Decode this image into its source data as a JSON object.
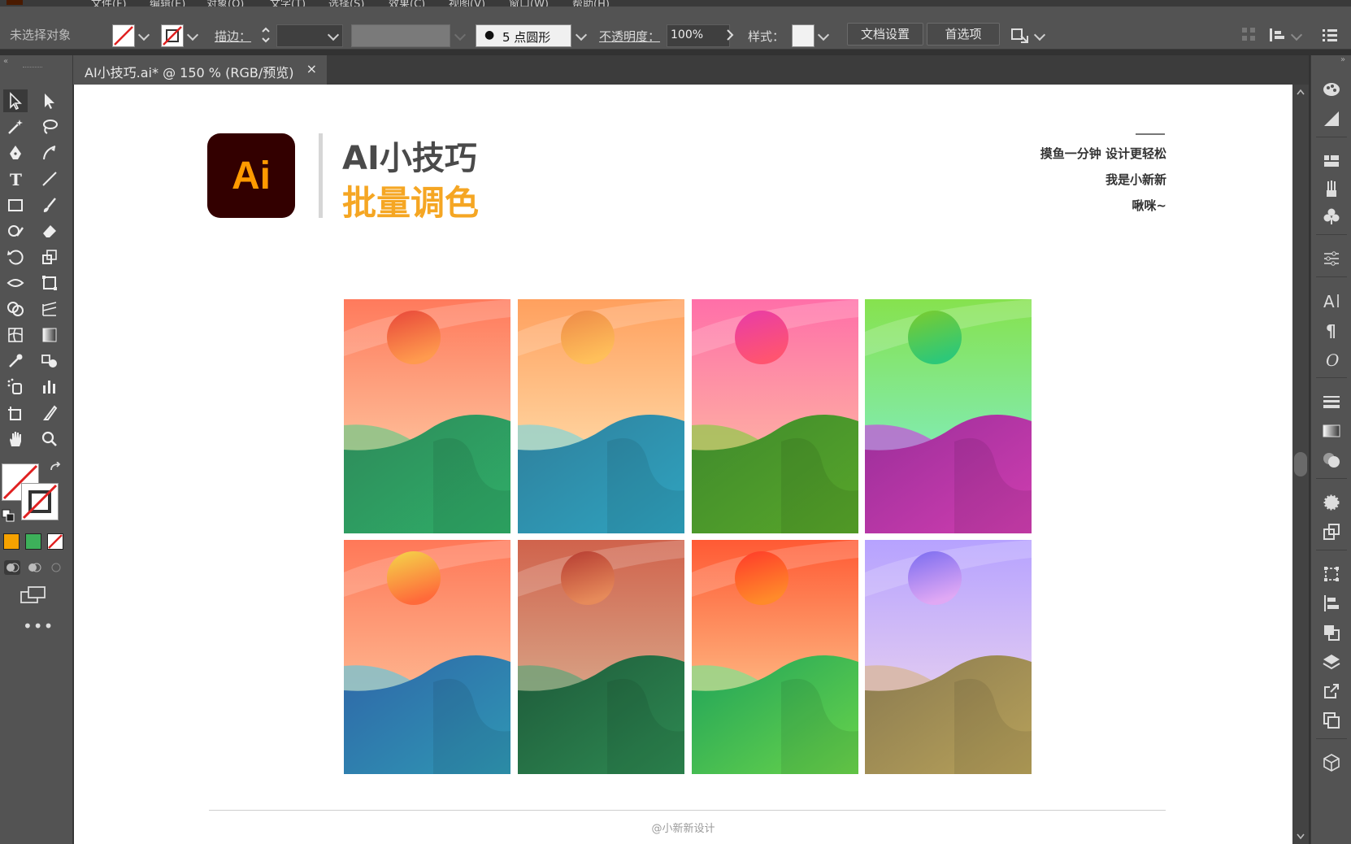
{
  "menubar": {
    "app_icon": "ai-app-icon",
    "items": [
      "文件(F)",
      "编辑(E)",
      "对象(O)",
      "文字(T)",
      "选择(S)",
      "效果(C)",
      "视图(V)",
      "窗口(W)",
      "帮助(H)"
    ]
  },
  "control_bar": {
    "selection_status": "未选择对象",
    "stroke_label": "描边：",
    "brush_label": "5 点圆形",
    "opacity_label": "不透明度：",
    "opacity_value": "100%",
    "style_label": "样式：",
    "doc_setup_button": "文档设置",
    "preferences_button": "首选项"
  },
  "document_tab": {
    "title": "AI小技巧.ai* @ 150 % (RGB/预览)",
    "close": "×"
  },
  "artboard": {
    "logo_text": "Ai",
    "title_line1": "AI小技巧",
    "title_line2": "批量调色",
    "tagline1": "摸鱼一分钟  设计更轻松",
    "tagline2": "我是小新新",
    "tagline3": "啾咪~",
    "footer": "@小新新设计",
    "cards": [
      {
        "name": "coral-green",
        "sky_top": "#ff7a5c",
        "sky_bottom": "#fde2b8",
        "sun_top": "#e8473a",
        "sun_bottom": "#ff9a4e",
        "back_hill": "#8fc48a",
        "hill_top": "#2e8a5a",
        "hill_bottom": "#2fae68"
      },
      {
        "name": "peach-teal",
        "sky_top": "#ffa05e",
        "sky_bottom": "#fff1c4",
        "sun_top": "#ee8a48",
        "sun_bottom": "#ffbf5a",
        "back_hill": "#9ed3c9",
        "hill_top": "#2f7f9c",
        "hill_bottom": "#2fa4c0"
      },
      {
        "name": "pink-green",
        "sky_top": "#ff6fa8",
        "sky_bottom": "#fcd0a0",
        "sun_top": "#e83ca8",
        "sun_bottom": "#ff5470",
        "back_hill": "#a6c25c",
        "hill_top": "#3f8a2c",
        "hill_bottom": "#58a62a"
      },
      {
        "name": "lime-purple",
        "sky_top": "#86e24e",
        "sky_bottom": "#7ff0e6",
        "sun_top": "#7ccc2e",
        "sun_bottom": "#2ec878",
        "back_hill": "#b86fd0",
        "hill_top": "#9a2e9a",
        "hill_bottom": "#d03eb0"
      },
      {
        "name": "orange-blue",
        "sky_top": "#ff7858",
        "sky_bottom": "#fcd6ac",
        "sun_top": "#f4d64a",
        "sun_bottom": "#ff6a3a",
        "back_hill": "#8ac0c8",
        "hill_top": "#2f66a8",
        "hill_bottom": "#2f98b4"
      },
      {
        "name": "rust-forest",
        "sky_top": "#d0634c",
        "sky_bottom": "#dcc4a4",
        "sun_top": "#b63c32",
        "sun_bottom": "#e68a5a",
        "back_hill": "#7aa27a",
        "hill_top": "#1e5a3a",
        "hill_bottom": "#2e8a52"
      },
      {
        "name": "flame-emerald",
        "sky_top": "#ff5a34",
        "sky_bottom": "#fde6a8",
        "sun_top": "#ff3a2a",
        "sun_bottom": "#ff8a2a",
        "back_hill": "#9ad68a",
        "hill_top": "#1fa35a",
        "hill_bottom": "#6ad44a"
      },
      {
        "name": "lavender-olive",
        "sky_top": "#b6a2ff",
        "sky_bottom": "#f8e0ea",
        "sun_top": "#7a6cf0",
        "sun_bottom": "#e0a8f4",
        "back_hill": "#d8b8a6",
        "hill_top": "#8a7a50",
        "hill_bottom": "#b8a25a"
      }
    ]
  },
  "colors": {
    "ui_panel": "#535353",
    "ui_dark": "#323232",
    "logo_bg": "#330000",
    "logo_orange": "#ff9a00",
    "title_orange": "#f5a623"
  }
}
